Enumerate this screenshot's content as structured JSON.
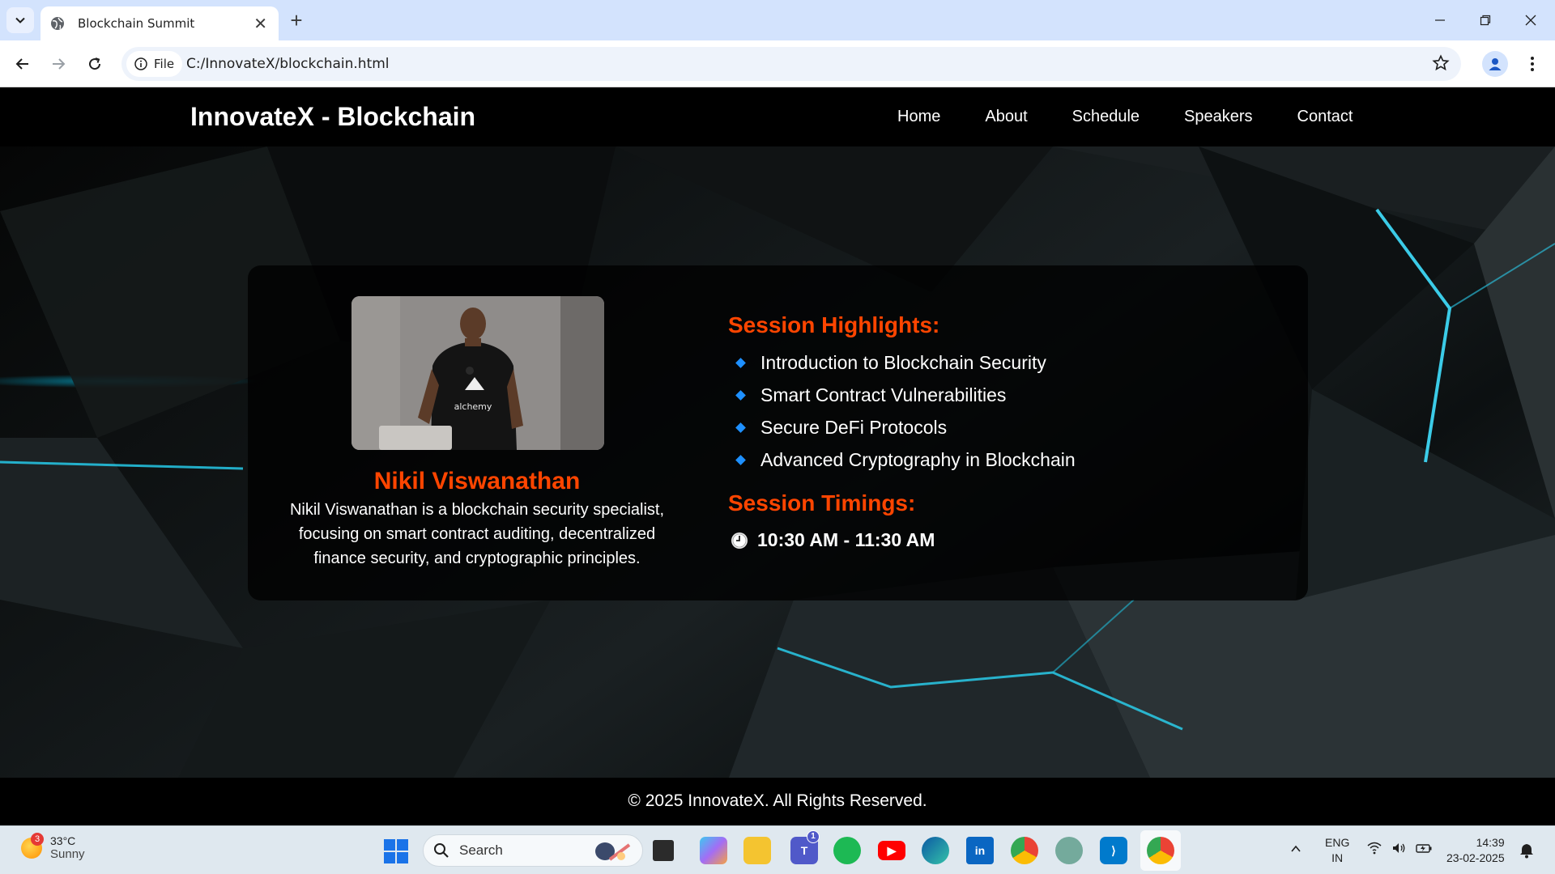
{
  "browser": {
    "tab_title": "Blockchain Summit",
    "site_info_label": "File",
    "url": "C:/InnovateX/blockchain.html"
  },
  "site": {
    "brand": "InnovateX - Blockchain",
    "nav": [
      "Home",
      "About",
      "Schedule",
      "Speakers",
      "Contact"
    ],
    "accent_color": "#ff4500",
    "bullet_color": "#1e90ff"
  },
  "speaker": {
    "name": "Nikil Viswanathan",
    "bio": "Nikil Viswanathan is a blockchain security specialist, focusing on smart contract auditing, decentralized finance security, and cryptographic principles.",
    "photo_shirt_text": "alchemy"
  },
  "highlights": {
    "title": "Session Highlights:",
    "items": [
      "Introduction to Blockchain Security",
      "Smart Contract Vulnerabilities",
      "Secure DeFi Protocols",
      "Advanced Cryptography in Blockchain"
    ]
  },
  "timings": {
    "title": "Session Timings:",
    "time": "10:30 AM - 11:30 AM",
    "icon": "clock-icon"
  },
  "footer": {
    "text": "© 2025 InnovateX. All Rights Reserved."
  },
  "taskbar": {
    "weather_temp": "33°C",
    "weather_desc": "Sunny",
    "weather_badge": "3",
    "search_label": "Search",
    "teams_badge": "1",
    "lang_line1": "ENG",
    "lang_line2": "IN",
    "time": "14:39",
    "date": "23-02-2025"
  }
}
